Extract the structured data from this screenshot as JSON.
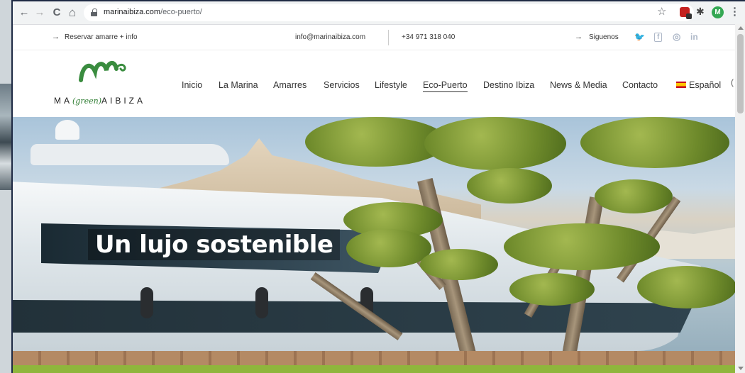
{
  "browser": {
    "url_domain": "marinaibiza.com",
    "url_path": "/eco-puerto/",
    "avatar_letter": "M",
    "back_icon": "←",
    "forward_icon": "→",
    "reload_icon": "C",
    "home_icon": "⌂",
    "star_icon": "☆",
    "puzzle_icon": "✱",
    "menu_icon": "⋮"
  },
  "topbar": {
    "reserve_arrow": "→",
    "reserve": "Reservar amarre + info",
    "email": "info@marinaibiza.com",
    "phone": "+34 971 318 040",
    "follow_arrow": "→",
    "follow": "Siguenos",
    "social": {
      "twitter": "🐦",
      "facebook": "f",
      "instagram": "◎",
      "linkedin": "in"
    }
  },
  "logo": {
    "pre": "MA",
    "mid": "(green)",
    "post": "AIBIZA"
  },
  "nav": {
    "items": [
      "Inicio",
      "La Marina",
      "Amarres",
      "Servicios",
      "Lifestyle",
      "Eco-Puerto",
      "Destino Ibiza",
      "News & Media",
      "Contacto",
      "Español"
    ],
    "active": "Eco-Puerto",
    "cut": "("
  },
  "hero": {
    "title": "Un lujo sostenible"
  },
  "colors": {
    "accent_green": "#2e7d32",
    "social_grey": "#aeb8c8",
    "avatar_green": "#34a853"
  }
}
